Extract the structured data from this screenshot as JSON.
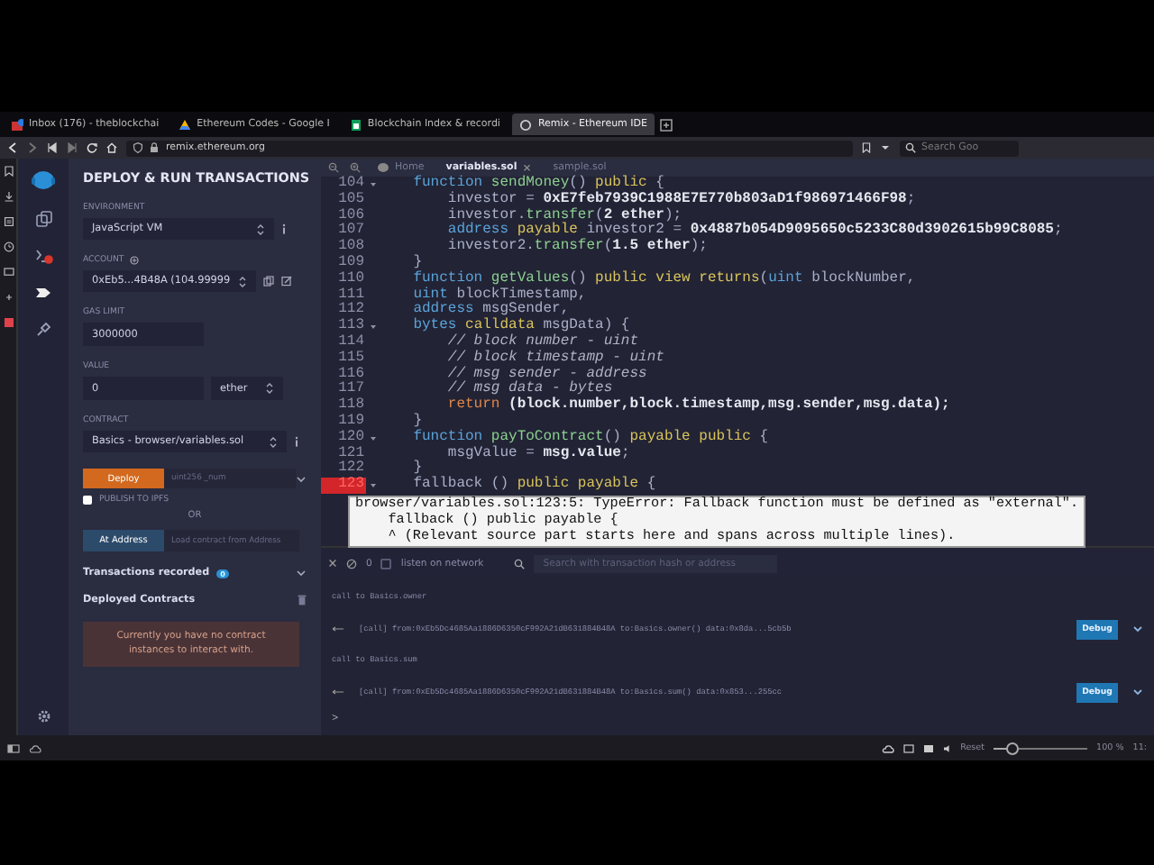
{
  "browser": {
    "tabs": [
      {
        "kind": "mail",
        "title": "Inbox (176) - theblockchai",
        "selected": false
      },
      {
        "kind": "drive",
        "title": "Ethereum Codes - Google I",
        "selected": false
      },
      {
        "kind": "sheets",
        "title": "Blockchain Index & recordi",
        "selected": false
      },
      {
        "kind": "remix",
        "title": "Remix - Ethereum IDE",
        "selected": true
      }
    ],
    "url": "remix.ethereum.org",
    "search_placeholder": "Search Goo"
  },
  "deploy_panel": {
    "title": "DEPLOY & RUN TRANSACTIONS",
    "environment": {
      "label": "ENVIRONMENT",
      "value": "JavaScript VM"
    },
    "account": {
      "label": "ACCOUNT",
      "value": "0xEb5...4B48A (104.99999"
    },
    "gas_limit": {
      "label": "GAS LIMIT",
      "value": "3000000"
    },
    "value": {
      "label": "VALUE",
      "value": "0",
      "unit": "ether"
    },
    "contract": {
      "label": "CONTRACT",
      "value": "Basics - browser/variables.sol"
    },
    "deploy": {
      "button": "Deploy",
      "placeholder": "uint256 _num"
    },
    "publish": {
      "label": "PUBLISH TO IPFS",
      "checked": false
    },
    "or": "OR",
    "at_address": {
      "button": "At Address",
      "placeholder": "Load contract from Address"
    },
    "transactions": {
      "label": "Transactions recorded",
      "count": "0"
    },
    "deployed": {
      "label": "Deployed Contracts"
    },
    "notice": "Currently you have no contract instances to interact with."
  },
  "editor": {
    "tabs": [
      {
        "title": "Home",
        "selected": false
      },
      {
        "title": "variables.sol",
        "selected": true,
        "close": "×"
      },
      {
        "title": "sample.sol",
        "selected": false
      }
    ],
    "lines": [
      {
        "number": "104",
        "foldable": true,
        "error": false,
        "code": [
          {
            "kind": "keyword",
            "text": "    function "
          },
          {
            "kind": "name",
            "text": "sendMoney"
          },
          {
            "kind": "plain",
            "text": "() "
          },
          {
            "kind": "modifier",
            "text": "public"
          },
          {
            "kind": "plain",
            "text": " {"
          }
        ]
      },
      {
        "number": "105",
        "foldable": false,
        "error": false,
        "code": [
          {
            "kind": "plain",
            "text": "        investor = "
          },
          {
            "kind": "literal",
            "text": "0xE7feb7939C1988E7E770b803aD1f986971466F98"
          },
          {
            "kind": "plain",
            "text": ";"
          }
        ]
      },
      {
        "number": "106",
        "foldable": false,
        "error": false,
        "code": [
          {
            "kind": "plain",
            "text": "        investor."
          },
          {
            "kind": "name",
            "text": "transfer"
          },
          {
            "kind": "plain",
            "text": "("
          },
          {
            "kind": "literal",
            "text": "2 ether"
          },
          {
            "kind": "plain",
            "text": ");"
          }
        ]
      },
      {
        "number": "107",
        "foldable": false,
        "error": false,
        "code": [
          {
            "kind": "keyword",
            "text": "        address "
          },
          {
            "kind": "modifier",
            "text": "payable"
          },
          {
            "kind": "plain",
            "text": " investor2 = "
          },
          {
            "kind": "literal",
            "text": "0x4887b054D9095650c5233C80d3902615b99C8085"
          },
          {
            "kind": "plain",
            "text": ";"
          }
        ]
      },
      {
        "number": "108",
        "foldable": false,
        "error": false,
        "code": [
          {
            "kind": "plain",
            "text": "        investor2."
          },
          {
            "kind": "name",
            "text": "transfer"
          },
          {
            "kind": "plain",
            "text": "("
          },
          {
            "kind": "literal",
            "text": "1.5 ether"
          },
          {
            "kind": "plain",
            "text": ");"
          }
        ]
      },
      {
        "number": "109",
        "foldable": false,
        "error": false,
        "code": [
          {
            "kind": "plain",
            "text": "    }"
          }
        ]
      },
      {
        "number": "110",
        "foldable": false,
        "error": false,
        "code": [
          {
            "kind": "keyword",
            "text": "    function "
          },
          {
            "kind": "name",
            "text": "getValues"
          },
          {
            "kind": "plain",
            "text": "() "
          },
          {
            "kind": "modifier",
            "text": "public view returns"
          },
          {
            "kind": "plain",
            "text": "("
          },
          {
            "kind": "keyword",
            "text": "uint"
          },
          {
            "kind": "plain",
            "text": " blockNumber,"
          }
        ]
      },
      {
        "number": "111",
        "foldable": false,
        "error": false,
        "code": [
          {
            "kind": "keyword",
            "text": "    uint"
          },
          {
            "kind": "plain",
            "text": " blockTimestamp,"
          }
        ]
      },
      {
        "number": "112",
        "foldable": false,
        "error": false,
        "code": [
          {
            "kind": "keyword",
            "text": "    address"
          },
          {
            "kind": "plain",
            "text": " msgSender,"
          }
        ]
      },
      {
        "number": "113",
        "foldable": true,
        "error": false,
        "code": [
          {
            "kind": "keyword",
            "text": "    bytes "
          },
          {
            "kind": "modifier",
            "text": "calldata"
          },
          {
            "kind": "plain",
            "text": " msgData) {"
          }
        ]
      },
      {
        "number": "114",
        "foldable": false,
        "error": false,
        "code": [
          {
            "kind": "comment",
            "text": "        // block number - uint"
          }
        ]
      },
      {
        "number": "115",
        "foldable": false,
        "error": false,
        "code": [
          {
            "kind": "comment",
            "text": "        // block timestamp - uint"
          }
        ]
      },
      {
        "number": "116",
        "foldable": false,
        "error": false,
        "code": [
          {
            "kind": "comment",
            "text": "        // msg sender - address"
          }
        ]
      },
      {
        "number": "117",
        "foldable": false,
        "error": false,
        "code": [
          {
            "kind": "comment",
            "text": "        // msg data - bytes"
          }
        ]
      },
      {
        "number": "118",
        "foldable": false,
        "error": false,
        "code": [
          {
            "kind": "control",
            "text": "        return "
          },
          {
            "kind": "literal",
            "text": "(block.number,block.timestamp,msg.sender,msg.data);"
          }
        ]
      },
      {
        "number": "119",
        "foldable": false,
        "error": false,
        "code": [
          {
            "kind": "plain",
            "text": "    }"
          }
        ]
      },
      {
        "number": "120",
        "foldable": true,
        "error": false,
        "code": [
          {
            "kind": "keyword",
            "text": "    function "
          },
          {
            "kind": "name",
            "text": "payToContract"
          },
          {
            "kind": "plain",
            "text": "() "
          },
          {
            "kind": "modifier",
            "text": "payable public"
          },
          {
            "kind": "plain",
            "text": " {"
          }
        ]
      },
      {
        "number": "121",
        "foldable": false,
        "error": false,
        "code": [
          {
            "kind": "plain",
            "text": "        msgValue = "
          },
          {
            "kind": "literal",
            "text": "msg.value"
          },
          {
            "kind": "plain",
            "text": ";"
          }
        ]
      },
      {
        "number": "122",
        "foldable": false,
        "error": false,
        "code": [
          {
            "kind": "plain",
            "text": "    }"
          }
        ]
      },
      {
        "number": "123",
        "foldable": true,
        "error": true,
        "code": [
          {
            "kind": "plain",
            "text": "    fallback () "
          },
          {
            "kind": "modifier",
            "text": "public payable"
          },
          {
            "kind": "plain",
            "text": " {"
          }
        ]
      }
    ],
    "error_tooltip": [
      "browser/variables.sol:123:5: TypeError: Fallback function must be defined as \"external\".",
      "    fallback () public payable {",
      "    ^ (Relevant source part starts here and spans across multiple lines)."
    ]
  },
  "terminal": {
    "count": "0",
    "listen": {
      "label": "listen on network",
      "checked": false
    },
    "search_placeholder": "Search with transaction hash or address",
    "logs": [
      {
        "kind": "call",
        "text": "call to Basics.owner"
      },
      {
        "kind": "tx",
        "text": "[call] from:0xEb5Dc4685Aa1886D6350cF992A21dB631884B48A to:Basics.owner() data:0x8da...5cb5b",
        "button": "Debug"
      },
      {
        "kind": "call",
        "text": "call to Basics.sum"
      },
      {
        "kind": "tx",
        "text": "[call] from:0xEb5Dc4685Aa1886D6350cF992A21dB631884B48A to:Basics.sum() data:0x853...255cc",
        "button": "Debug"
      }
    ],
    "prompt": ">"
  },
  "status_bar": {
    "reset": "Reset",
    "zoom": {
      "level": 0.2
    },
    "zoom_label": "100 %",
    "clock": "11:"
  }
}
